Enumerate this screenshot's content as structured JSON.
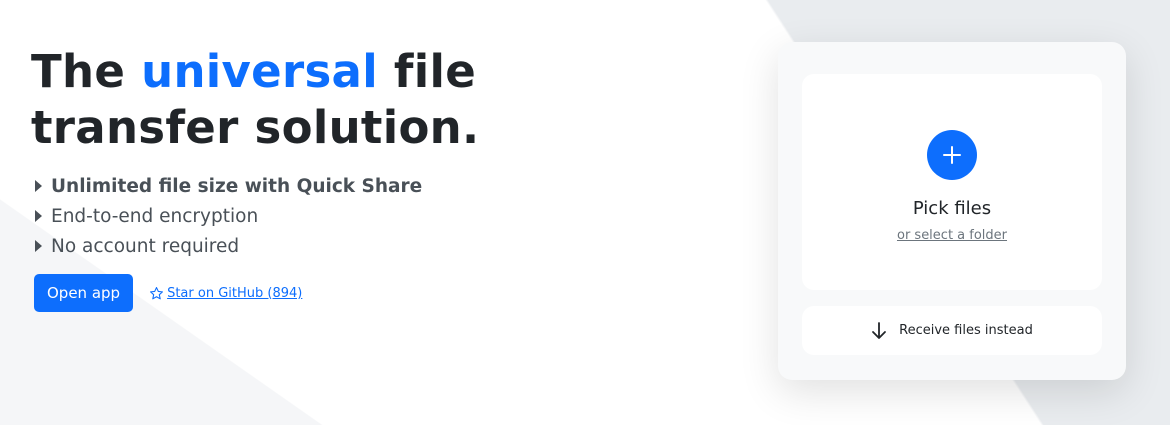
{
  "hero": {
    "headline_prefix": "The ",
    "headline_accent": "universal",
    "headline_suffix": " file transfer solution.",
    "features": [
      {
        "label": "Unlimited file size with Quick Share",
        "bold": true
      },
      {
        "label": "End-to-end encryption",
        "bold": false
      },
      {
        "label": "No account required",
        "bold": false
      }
    ],
    "open_app_label": "Open app",
    "star_label": "Star on GitHub (894)"
  },
  "card": {
    "pick_title": "Pick files",
    "folder_link": "or select a folder",
    "receive_label": "Receive files instead"
  },
  "colors": {
    "accent": "#0d6efd",
    "text": "#212529",
    "muted": "#495057",
    "card_bg": "#f8f9fa"
  },
  "icons": {
    "bullet": "triangle-right-icon",
    "star": "star-outline-icon",
    "plus": "plus-icon",
    "receive": "arrow-down-icon"
  }
}
